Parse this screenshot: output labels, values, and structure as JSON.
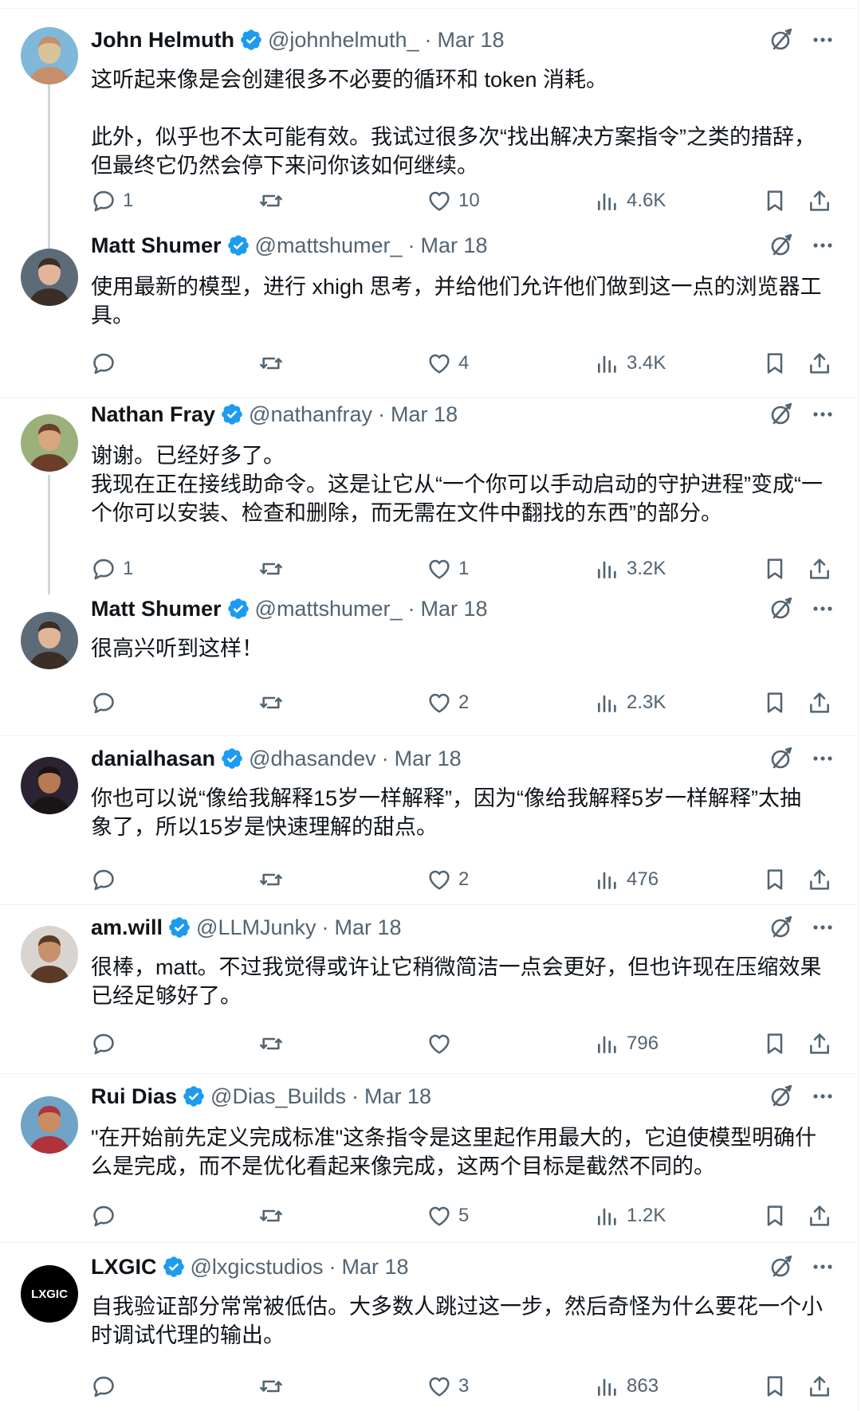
{
  "tweets": [
    {
      "name": "John Helmuth",
      "handle": "@johnhelmuth_",
      "date": "Mar 18",
      "text": "这听起来像是会创建很多不必要的循环和 token 消耗。\n\n此外，似乎也不太可能有效。我试过很多次“找出解决方案指令”之类的措辞，\n但最终它仍然会停下来问你该如何继续。",
      "replies": "1",
      "reposts": "",
      "likes": "10",
      "views": "4.6K",
      "avatar_colors": [
        "#7fb8d8",
        "#d9c49a",
        "#c48f6a"
      ]
    },
    {
      "name": "Matt Shumer",
      "handle": "@mattshumer_",
      "date": "Mar 18",
      "text": "使用最新的模型，进行 xhigh 思考，并给他们允许他们做到这一点的浏览器工\n具。",
      "replies": "",
      "reposts": "",
      "likes": "4",
      "views": "3.4K",
      "avatar_colors": [
        "#5d6b78",
        "#e2b59a",
        "#3a2e26"
      ]
    },
    {
      "name": "Nathan Fray",
      "handle": "@nathanfray",
      "date": "Mar 18",
      "text": "谢谢。已经好多了。\n我现在正在接线助命令。这是让它从“一个你可以手动启动的守护进程”变成“一\n个你可以安装、检查和删除，而无需在文件中翻找的东西”的部分。",
      "replies": "1",
      "reposts": "",
      "likes": "1",
      "views": "3.2K",
      "avatar_colors": [
        "#9bb07a",
        "#d8a77f",
        "#6b3d2a"
      ]
    },
    {
      "name": "Matt Shumer",
      "handle": "@mattshumer_",
      "date": "Mar 18",
      "text": "很高兴听到这样！",
      "replies": "",
      "reposts": "",
      "likes": "2",
      "views": "2.3K",
      "avatar_colors": [
        "#5d6b78",
        "#e2b59a",
        "#3a2e26"
      ]
    },
    {
      "name": "danialhasan",
      "handle": "@dhasandev",
      "date": "Mar 18",
      "text": "你也可以说“像给我解释15岁一样解释”，因为“像给我解释5岁一样解释”太抽\n象了，所以15岁是快速理解的甜点。",
      "replies": "",
      "reposts": "",
      "likes": "2",
      "views": "476",
      "avatar_colors": [
        "#2b2233",
        "#b77a52",
        "#1a1414"
      ]
    },
    {
      "name": "am.will",
      "handle": "@LLMJunky",
      "date": "Mar 18",
      "text": "很棒，matt。不过我觉得或许让它稍微简洁一点会更好，但也许现在压缩效果\n已经足够好了。",
      "replies": "",
      "reposts": "",
      "likes": "",
      "views": "796",
      "avatar_colors": [
        "#d9d4cf",
        "#c9906e",
        "#5a3a26"
      ]
    },
    {
      "name": "Rui Dias",
      "handle": "@Dias_Builds",
      "date": "Mar 18",
      "text": "\"在开始前先定义完成标准\"这条指令是这里起作用最大的，它迫使模型明确什\n么是完成，而不是优化看起来像完成，这两个目标是截然不同的。",
      "replies": "",
      "reposts": "",
      "likes": "5",
      "views": "1.2K",
      "avatar_colors": [
        "#6fa3c7",
        "#c98d62",
        "#b0323a"
      ]
    },
    {
      "name": "LXGIC",
      "handle": "@lxgicstudios",
      "date": "Mar 18",
      "text": "自我验证部分常常被低估。大多数人跳过这一步，然后奇怪为什么要花一个小\n时调试代理的输出。",
      "replies": "",
      "reposts": "",
      "likes": "3",
      "views": "863",
      "avatar_colors": [
        "#000000",
        "#ffffff",
        "#000000"
      ],
      "avatar_logo_text": "LXGIC"
    }
  ],
  "colors": {
    "text": "#0f1419",
    "secondary": "#536471",
    "verified": "#1d9bf0",
    "divider": "#eff3f4",
    "thread_line": "#cfd9de"
  }
}
